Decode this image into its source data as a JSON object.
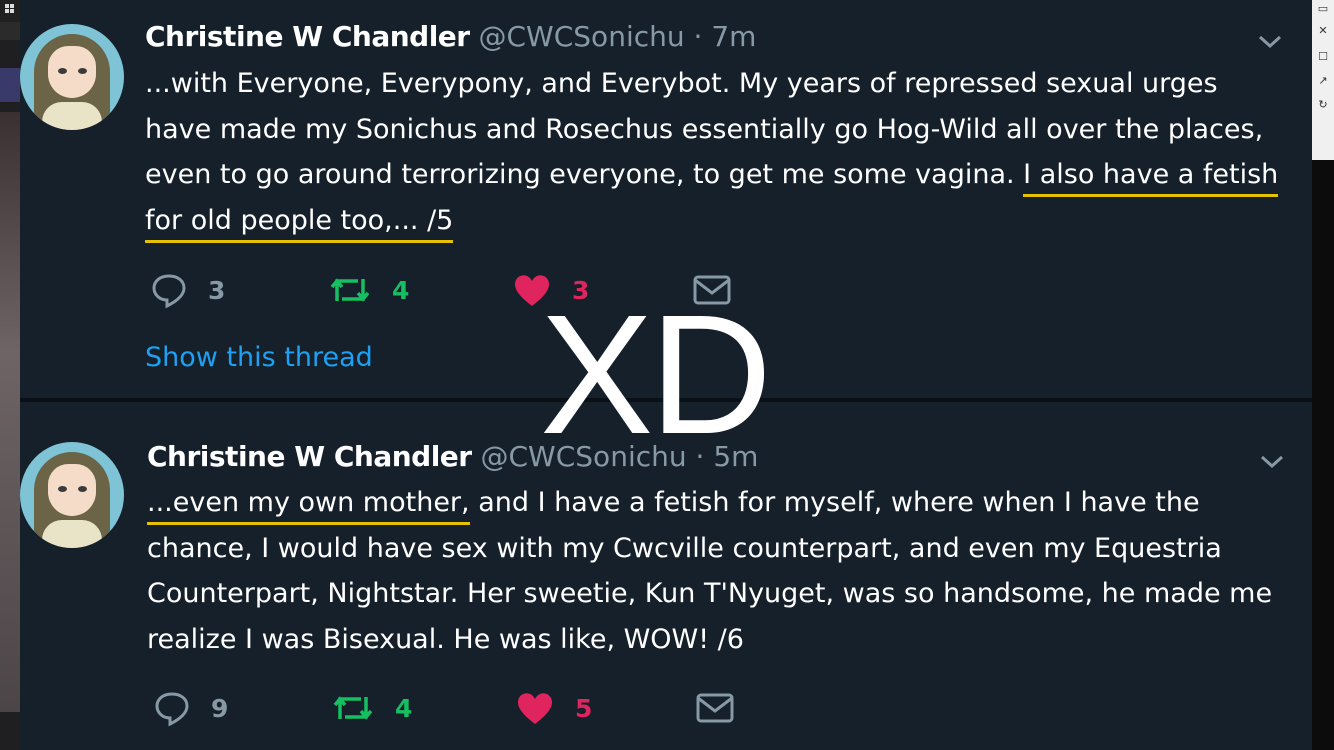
{
  "tweets": [
    {
      "name": "Christine W Chandler",
      "handle": "@CWCSonichu",
      "separator": "·",
      "time": "7m",
      "text_1": "...with Everyone, Everypony, and Everybot.  My years of repressed sexual urges have made my Sonichus and Rosechus essentially go Hog-Wild all over the places, even to go around terrorizing everyone, to get me some vagina. ",
      "text_underlined": "I also have a fetish for old people too,...  /5",
      "replies": "3",
      "retweets": "4",
      "likes": "3",
      "show_thread": "Show this thread"
    },
    {
      "name": "Christine W Chandler",
      "handle": "@CWCSonichu",
      "separator": "·",
      "time": "5m",
      "text_underlined": "...even my own mother,",
      "text_rest": " and I have a fetish for myself, where when I have the chance, I would have sex with my Cwcville counterpart, and even my Equestria Counterpart, Nightstar.  Her sweetie, Kun T'Nyuget, was so handsome, he made me realize I was Bisexual.  He was like, WOW!  /6",
      "replies": "9",
      "retweets": "4",
      "likes": "5"
    }
  ],
  "overlay_text": "XD",
  "colors": {
    "background": "#15202b",
    "text": "#ffffff",
    "muted": "#8899a6",
    "link": "#1da1f2",
    "retweet": "#17bf63",
    "like": "#e0245e",
    "underline": "#e5c100"
  },
  "icons": [
    "reply-icon",
    "retweet-icon",
    "like-icon",
    "message-icon",
    "chevron-down-icon"
  ]
}
